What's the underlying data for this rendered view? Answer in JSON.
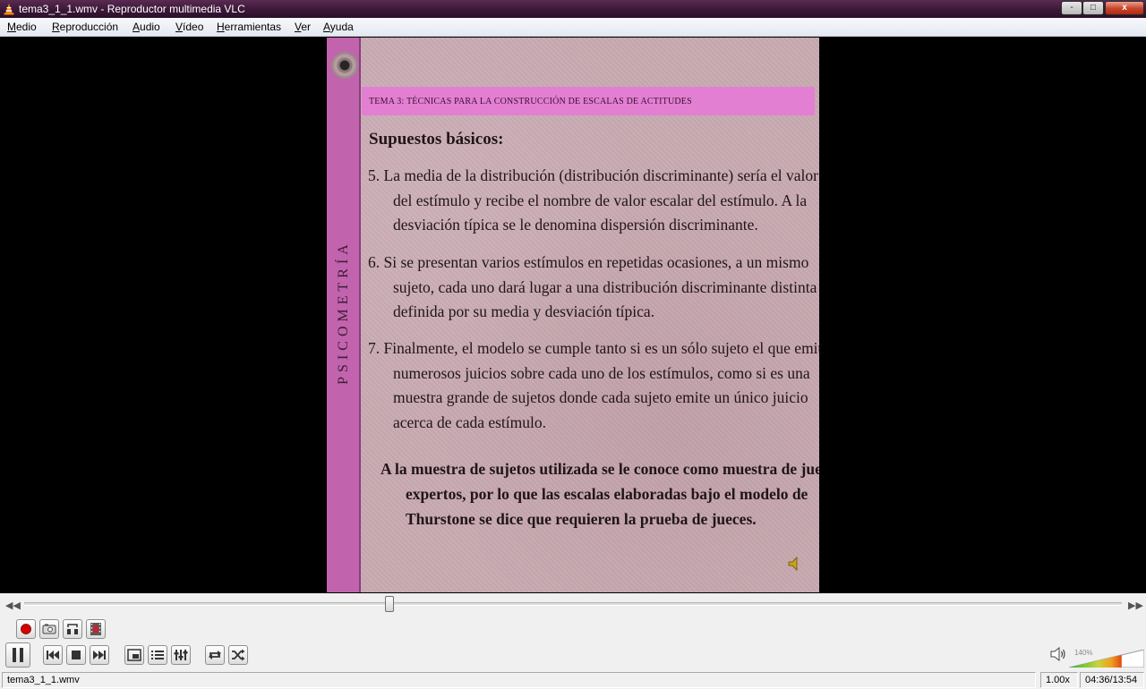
{
  "window": {
    "title": "tema3_1_1.wmv - Reproductor multimedia VLC",
    "controls": {
      "minimize": "-",
      "maximize": "□",
      "close": "x"
    }
  },
  "menu": [
    "Medio",
    "Reproducción",
    "Audio",
    "Vídeo",
    "Herramientas",
    "Ver",
    "Ayuda"
  ],
  "slide": {
    "vertical_text": "PSICOMETRÍA",
    "header": "TEMA 3: TÉCNICAS PARA LA CONSTRUCCIÓN DE ESCALAS DE ACTITUDES",
    "subtitle": "Supuestos básicos:",
    "points": [
      [
        "5. La media de la distribución (distribución discriminante) sería el valor",
        "del estímulo y recibe el nombre de valor escalar del estímulo. A la",
        "desviación típica se le denomina dispersión discriminante."
      ],
      [
        "6. Si se presentan varios estímulos en repetidas ocasiones, a un mismo",
        "sujeto, cada uno dará lugar a una distribución discriminante distinta",
        "definida por su media y desviación típica."
      ],
      [
        "7. Finalmente, el modelo se cumple tanto si es un sólo sujeto el que emite",
        "numerosos juicios sobre cada uno de los estímulos, como si es una",
        "muestra grande de sujetos donde cada sujeto emite un único juicio",
        "acerca de cada estímulo."
      ]
    ],
    "conclusion": [
      "A la muestra de sujetos utilizada se le conoce como muestra de jueces",
      "expertos, por lo que las escalas elaboradas bajo el modelo de",
      "Thurstone se dice que requieren la prueba de jueces."
    ]
  },
  "seek": {
    "position": 0.3325
  },
  "volume": {
    "label": "140%",
    "level": 0.7
  },
  "status": {
    "file": "tema3_1_1.wmv",
    "speed": "1.00x",
    "time": "04:36/13:54"
  },
  "colors": {
    "titlebar": "#3c1838",
    "slide_background": "#c9aab2",
    "slide_sidebar": "#c263ae",
    "slide_header": "#e37fd2",
    "record": "#d40000"
  },
  "icons": [
    "vlc-cone-icon",
    "record-icon",
    "snapshot-icon",
    "loop-ab-icon",
    "frame-step-icon",
    "pause-icon",
    "previous-icon",
    "stop-icon",
    "next-icon",
    "fullscreen-icon",
    "playlist-icon",
    "extended-settings-icon",
    "loop-icon",
    "random-icon",
    "speaker-icon"
  ]
}
